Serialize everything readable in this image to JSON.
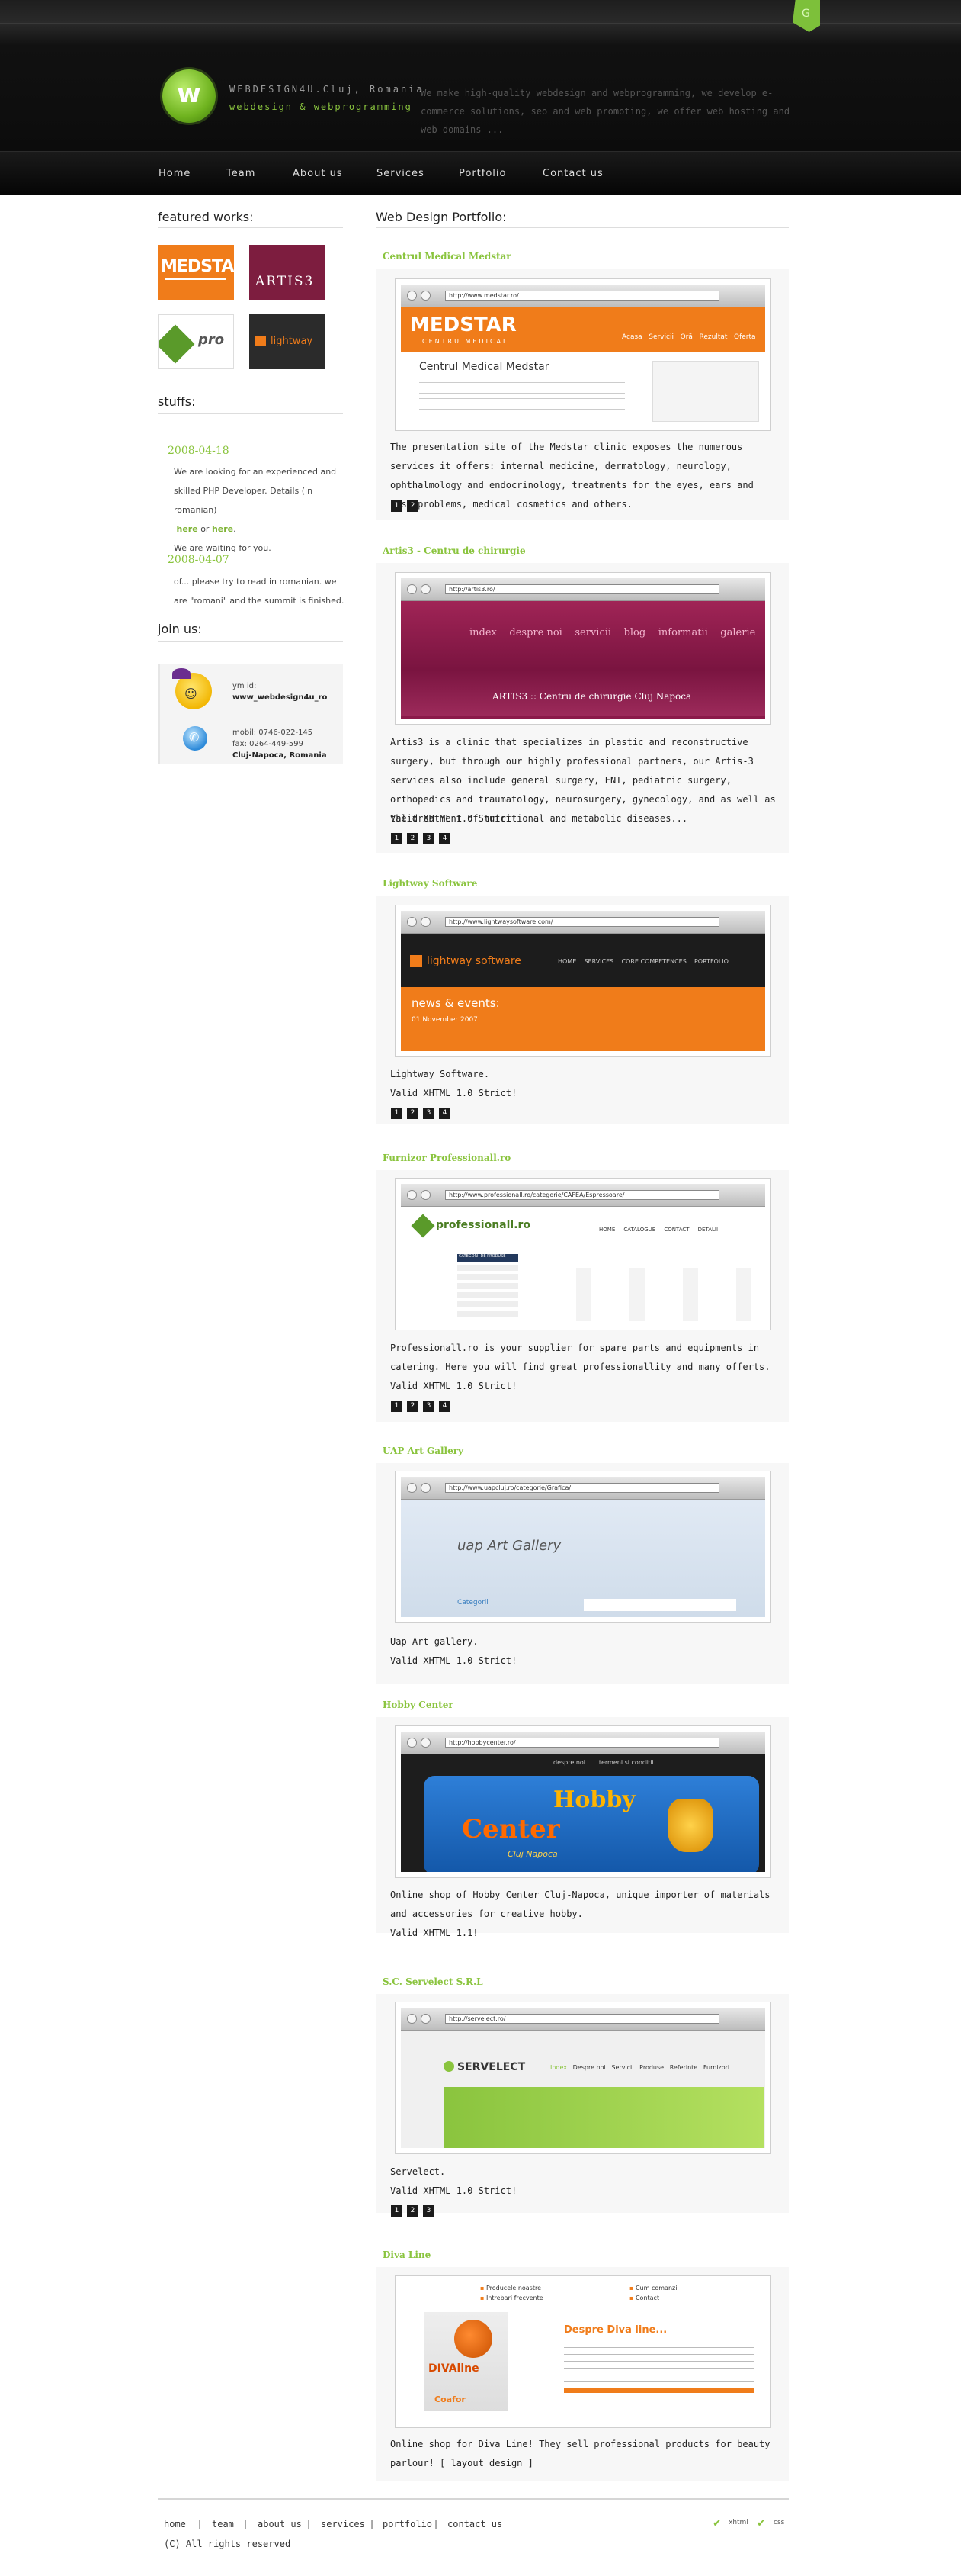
{
  "header": {
    "brand_name": "WEBDESIGN4U.Cluj, Romania",
    "brand_sub": "webdesign & webprogramming",
    "tagline": "We make high-quality webdesign and webprogramming, we develop e-commerce solutions, seo and web promoting, we offer web hosting and web domains ...",
    "logo_letter": "w",
    "corner_letter": "G"
  },
  "nav": [
    "Home",
    "Team",
    "About us",
    "Services",
    "Portfolio",
    "Contact us"
  ],
  "sidebar": {
    "featured_title": "featured works:",
    "featured": [
      "MEDSTAR",
      "ARTIS3",
      "pro",
      "lightway"
    ],
    "stuffs_title": "stuffs:",
    "news": [
      {
        "date": "2008-04-18",
        "text1": "We are looking for an experienced and skilled PHP Developer. Details (in romanian)",
        "link1": "here",
        "or": "or",
        "link2": "here",
        "end": ".",
        "text2": "We are waiting for you."
      },
      {
        "date": "2008-04-07",
        "text1": "of... please try to read in romanian. we are \"romani\" and the summit is finished."
      }
    ],
    "join_title": "join us:",
    "ym_label": "ym id:",
    "ym_id": "www_webdesign4u_ro",
    "mobil": "mobil: 0746-022-145",
    "fax": "fax: 0264-449-599",
    "city": "Cluj-Napoca, Romania"
  },
  "main": {
    "title": "Web Design Portfolio:",
    "projects": [
      {
        "title": "Centrul Medical Medstar",
        "url": "http://www.medstar.ro/",
        "desc": "The presentation site of the Medstar clinic exposes the numerous services it offers: internal medicine, dermatology, neurology, ophthalmology and endocrinology, treatments for the eyes, ears and nose problems, medical cosmetics and others.",
        "pages": [
          "1",
          "2"
        ]
      },
      {
        "title": "Artis3 - Centru de chirurgie",
        "url": "http://artis3.ro/",
        "desc": "Artis3 is a clinic that specializes in plastic and reconstructive surgery, but through our highly professional partners, our Artis-3 services also include general surgery, ENT, pediatric surgery, orthopedics and traumatology, neurosurgery, gynecology, and as well as the treatment of nutritional and metabolic diseases...",
        "valid": "Valid XHTML 1.0 Strict!",
        "pages": [
          "1",
          "2",
          "3",
          "4"
        ]
      },
      {
        "title": "Lightway Software",
        "url": "http://www.lightwaysoftware.com/",
        "desc": "Lightway Software.",
        "valid": "Valid XHTML 1.0 Strict!",
        "pages": [
          "1",
          "2",
          "3",
          "4"
        ]
      },
      {
        "title": "Furnizor Professionall.ro",
        "url": "http://www.professionall.ro/categorie/CAFEA/Espressoare/",
        "desc": "Professionall.ro is your supplier for spare parts and equipments in catering. Here you will find great professionallity and many offerts.",
        "valid": "Valid XHTML 1.0 Strict!",
        "pages": [
          "1",
          "2",
          "3",
          "4"
        ]
      },
      {
        "title": "UAP Art Gallery",
        "url": "http://www.uapcluj.ro/categorie/Grafica/",
        "desc": "Uap Art gallery.",
        "valid": "Valid XHTML 1.0 Strict!"
      },
      {
        "title": "Hobby Center",
        "url": "http://hobbycenter.ro/",
        "desc": "Online shop of Hobby Center Cluj-Napoca, unique importer of materials and accessories for creative hobby.",
        "valid": "Valid XHTML 1.1!"
      },
      {
        "title": "S.C. Servelect S.R.L",
        "url": "http://servelect.ro/",
        "desc": "Servelect.",
        "valid": "Valid XHTML 1.0 Strict!",
        "pages": [
          "1",
          "2",
          "3"
        ]
      },
      {
        "title": "Diva Line",
        "desc": "Online shop for Diva Line! They sell professional products for beauty parlour! [ layout design ]"
      }
    ]
  },
  "shots": {
    "medstar": {
      "logo": "MEDSTAR",
      "logo_sub": "CENTRU MEDICAL",
      "heading": "Centrul Medical Medstar",
      "nav": [
        "Acasa",
        "Servicii",
        "Oră",
        "Rezultat",
        "Oferta"
      ]
    },
    "artis": {
      "nav": [
        "index",
        "despre noi",
        "servicii",
        "blog",
        "informatii",
        "galerie"
      ],
      "caption": "ARTIS3 :: Centru de chirurgie Cluj Napoca"
    },
    "lightway": {
      "logo": "lightway software",
      "nav": [
        "HOME",
        "SERVICES",
        "CORE COMPETENCES",
        "PORTFOLIO"
      ],
      "news": "news & events:",
      "date": "01 November 2007"
    },
    "prof": {
      "logo": "professionall.ro",
      "nav": [
        "HOME",
        "CATALOGUE",
        "CONTACT",
        "DETALII"
      ],
      "side": "CATEGORII DE PRODUSE"
    },
    "uap": {
      "logo": "uap Art Gallery",
      "menu": "Categorii"
    },
    "hobby": {
      "brand_top": "Hobby",
      "brand_bottom": "Center",
      "city": "Cluj Napoca",
      "nav": [
        "despre noi",
        "termeni si conditii"
      ]
    },
    "servelect": {
      "logo": "SERVELECT",
      "nav": [
        "Index",
        "Despre noi",
        "Servicii",
        "Produse",
        "Referinte",
        "Furnizori"
      ]
    },
    "diva": {
      "logo": "DIVAline",
      "heading": "Despre Diva line...",
      "menu": [
        "Producele noastre",
        "Intrebari frecvente",
        "Cum comanzi",
        "Contact"
      ],
      "sub": "Coafor"
    }
  },
  "footer": {
    "links": [
      "home",
      "team",
      "about us",
      "services",
      "portfolio",
      "contact us"
    ],
    "copyright": "(C) All rights reserved",
    "valid": [
      "xhtml",
      "css"
    ]
  },
  "colors": {
    "accent": "#8ac43e",
    "header_bg": "#0c0c0c",
    "medstar_orange": "#f07c1a",
    "artis_purple": "#8b1a4a"
  }
}
